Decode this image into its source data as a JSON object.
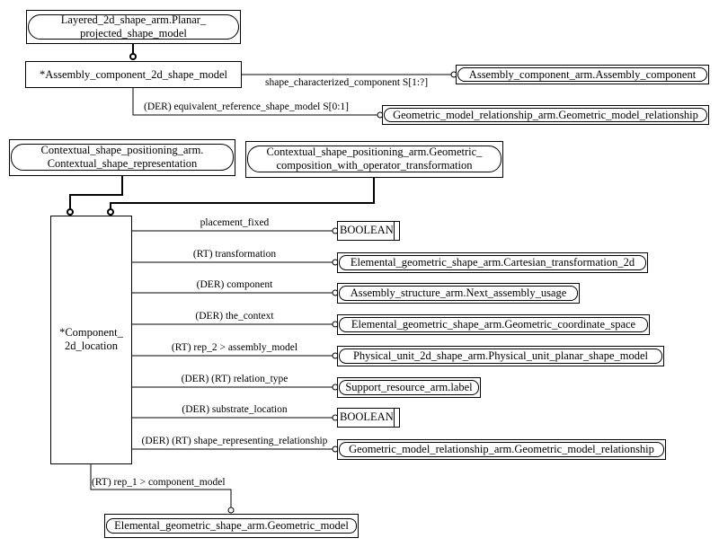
{
  "diagram": {
    "main_entities": {
      "assembly_component_2d_shape_model": "*Assembly_component_2d_shape_model",
      "component_2d_location_line1": "*Component_",
      "component_2d_location_line2": "2d_location"
    },
    "supertypes": {
      "planar_projected_shape_model_line1": "Layered_2d_shape_arm.Planar_",
      "planar_projected_shape_model_line2": "projected_shape_model",
      "contextual_shape_representation_line1": "Contextual_shape_positioning_arm.",
      "contextual_shape_representation_line2": "Contextual_shape_representation",
      "geometric_composition_line1": "Contextual_shape_positioning_arm.Geometric_",
      "geometric_composition_line2": "composition_with_operator_transformation"
    },
    "assembly_attributes": [
      {
        "label": "shape_characterized_component S[1:?]",
        "target": "Assembly_component_arm.Assembly_component"
      },
      {
        "label": "(DER) equivalent_reference_shape_model S[0:1]",
        "target": "Geometric_model_relationship_arm.Geometric_model_relationship"
      }
    ],
    "location_attributes": [
      {
        "label": "placement_fixed",
        "target": "BOOLEAN",
        "kind": "type"
      },
      {
        "label": "(RT) transformation",
        "target": "Elemental_geometric_shape_arm.Cartesian_transformation_2d",
        "kind": "entity"
      },
      {
        "label": "(DER) component",
        "target": "Assembly_structure_arm.Next_assembly_usage",
        "kind": "entity"
      },
      {
        "label": "(DER) the_context",
        "target": "Elemental_geometric_shape_arm.Geometric_coordinate_space",
        "kind": "entity"
      },
      {
        "label": "(RT) rep_2 > assembly_model",
        "target": "Physical_unit_2d_shape_arm.Physical_unit_planar_shape_model",
        "kind": "entity"
      },
      {
        "label": "(DER) (RT) relation_type",
        "target": "Support_resource_arm.label",
        "kind": "entity"
      },
      {
        "label": "(DER) substrate_location",
        "target": "BOOLEAN",
        "kind": "type"
      },
      {
        "label": "(DER) (RT) shape_representing_relationship",
        "target": "Geometric_model_relationship_arm.Geometric_model_relationship",
        "kind": "entity"
      }
    ],
    "bottom_attribute": {
      "label": "(RT) rep_1 > component_model",
      "target": "Elemental_geometric_shape_arm.Geometric_model"
    }
  }
}
